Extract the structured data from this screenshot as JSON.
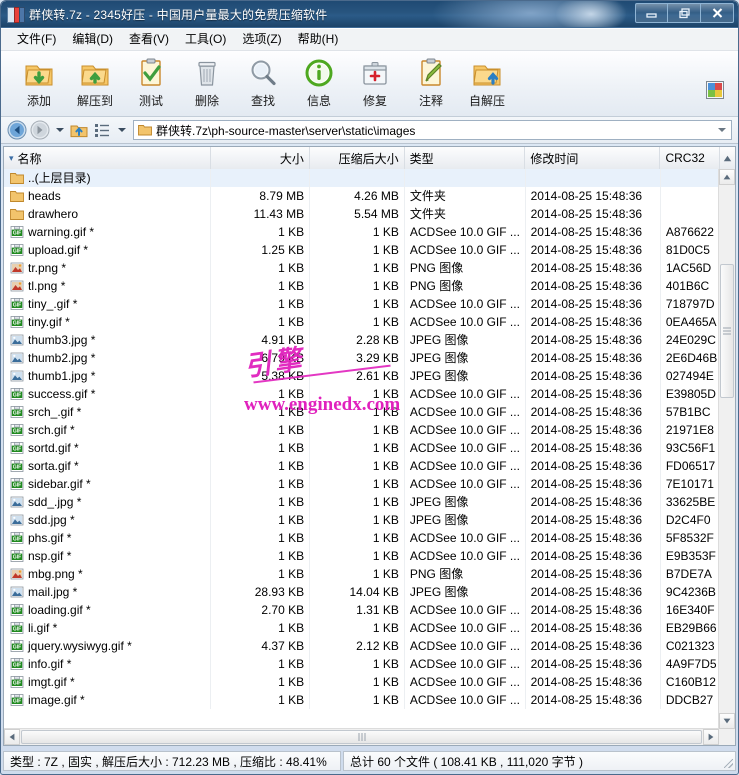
{
  "window": {
    "title": "群侠转.7z - 2345好压 - 中国用户量最大的免费压缩软件",
    "app_icon": "archive-icon",
    "minimize_label": "最小化",
    "restore_label": "还原",
    "close_label": "关闭"
  },
  "menu": [
    {
      "label": "文件(F)"
    },
    {
      "label": "编辑(D)"
    },
    {
      "label": "查看(V)"
    },
    {
      "label": "工具(O)"
    },
    {
      "label": "选项(Z)"
    },
    {
      "label": "帮助(H)"
    }
  ],
  "toolbar": {
    "buttons": [
      {
        "label": "添加",
        "icon": "folder-add-icon"
      },
      {
        "label": "解压到",
        "icon": "folder-extract-icon"
      },
      {
        "label": "测试",
        "icon": "clipboard-check-icon"
      },
      {
        "label": "删除",
        "icon": "trash-icon"
      },
      {
        "label": "查找",
        "icon": "magnifier-icon"
      },
      {
        "label": "信息",
        "icon": "info-icon"
      },
      {
        "label": "修复",
        "icon": "first-aid-icon"
      },
      {
        "label": "注释",
        "icon": "clipboard-pencil-icon"
      },
      {
        "label": "自解压",
        "icon": "folder-sfx-icon"
      }
    ],
    "right_icon": "palette-icon"
  },
  "address": {
    "back_icon": "back-arrow-icon",
    "forward_icon": "forward-arrow-icon",
    "dropdown_icon": "chevron-down-icon",
    "up_icon": "up-folder-icon",
    "view_icon": "list-view-icon",
    "view_dropdown_icon": "chevron-down-icon",
    "folder_icon": "folder-icon",
    "path": "群侠转.7z\\ph-source-master\\server\\static\\images"
  },
  "list": {
    "columns": [
      {
        "key": "name",
        "label": "名称",
        "align": "left",
        "sorted": true
      },
      {
        "key": "size",
        "label": "大小",
        "align": "right"
      },
      {
        "key": "psize",
        "label": "压缩后大小",
        "align": "right"
      },
      {
        "key": "type",
        "label": "类型",
        "align": "left"
      },
      {
        "key": "date",
        "label": "修改时间",
        "align": "left"
      },
      {
        "key": "crc",
        "label": "CRC32",
        "align": "left"
      }
    ],
    "rows": [
      {
        "icon": "folder-up-icon",
        "name": "..(上层目录)",
        "size": "",
        "psize": "",
        "type": "",
        "date": "",
        "crc": "",
        "selected": true
      },
      {
        "icon": "folder-icon",
        "name": "heads",
        "size": "8.79 MB",
        "psize": "4.26 MB",
        "type": "文件夹",
        "date": "2014-08-25 15:48:36",
        "crc": ""
      },
      {
        "icon": "folder-icon",
        "name": "drawhero",
        "size": "11.43 MB",
        "psize": "5.54 MB",
        "type": "文件夹",
        "date": "2014-08-25 15:48:36",
        "crc": ""
      },
      {
        "icon": "gif-icon",
        "name": "warning.gif *",
        "size": "1 KB",
        "psize": "1 KB",
        "type": "ACDSee 10.0 GIF ...",
        "date": "2014-08-25 15:48:36",
        "crc": "A876622"
      },
      {
        "icon": "gif-icon",
        "name": "upload.gif *",
        "size": "1.25 KB",
        "psize": "1 KB",
        "type": "ACDSee 10.0 GIF ...",
        "date": "2014-08-25 15:48:36",
        "crc": "81D0C5"
      },
      {
        "icon": "png-icon",
        "name": "tr.png *",
        "size": "1 KB",
        "psize": "1 KB",
        "type": "PNG 图像",
        "date": "2014-08-25 15:48:36",
        "crc": "1AC56D"
      },
      {
        "icon": "png-icon",
        "name": "tl.png *",
        "size": "1 KB",
        "psize": "1 KB",
        "type": "PNG 图像",
        "date": "2014-08-25 15:48:36",
        "crc": "401B6C"
      },
      {
        "icon": "gif-icon",
        "name": "tiny_.gif *",
        "size": "1 KB",
        "psize": "1 KB",
        "type": "ACDSee 10.0 GIF ...",
        "date": "2014-08-25 15:48:36",
        "crc": "718797D"
      },
      {
        "icon": "gif-icon",
        "name": "tiny.gif *",
        "size": "1 KB",
        "psize": "1 KB",
        "type": "ACDSee 10.0 GIF ...",
        "date": "2014-08-25 15:48:36",
        "crc": "0EA465A"
      },
      {
        "icon": "jpg-icon",
        "name": "thumb3.jpg *",
        "size": "4.91 KB",
        "psize": "2.28 KB",
        "type": "JPEG 图像",
        "date": "2014-08-25 15:48:36",
        "crc": "24E029C"
      },
      {
        "icon": "jpg-icon",
        "name": "thumb2.jpg *",
        "size": "6.79 KB",
        "psize": "3.29 KB",
        "type": "JPEG 图像",
        "date": "2014-08-25 15:48:36",
        "crc": "2E6D46B"
      },
      {
        "icon": "jpg-icon",
        "name": "thumb1.jpg *",
        "size": "5.38 KB",
        "psize": "2.61 KB",
        "type": "JPEG 图像",
        "date": "2014-08-25 15:48:36",
        "crc": "027494E"
      },
      {
        "icon": "gif-icon",
        "name": "success.gif *",
        "size": "1 KB",
        "psize": "1 KB",
        "type": "ACDSee 10.0 GIF ...",
        "date": "2014-08-25 15:48:36",
        "crc": "E39805D"
      },
      {
        "icon": "gif-icon",
        "name": "srch_.gif *",
        "size": "1 KB",
        "psize": "1 KB",
        "type": "ACDSee 10.0 GIF ...",
        "date": "2014-08-25 15:48:36",
        "crc": "57B1BC"
      },
      {
        "icon": "gif-icon",
        "name": "srch.gif *",
        "size": "1 KB",
        "psize": "1 KB",
        "type": "ACDSee 10.0 GIF ...",
        "date": "2014-08-25 15:48:36",
        "crc": "21971E8"
      },
      {
        "icon": "gif-icon",
        "name": "sortd.gif *",
        "size": "1 KB",
        "psize": "1 KB",
        "type": "ACDSee 10.0 GIF ...",
        "date": "2014-08-25 15:48:36",
        "crc": "93C56F1"
      },
      {
        "icon": "gif-icon",
        "name": "sorta.gif *",
        "size": "1 KB",
        "psize": "1 KB",
        "type": "ACDSee 10.0 GIF ...",
        "date": "2014-08-25 15:48:36",
        "crc": "FD06517"
      },
      {
        "icon": "gif-icon",
        "name": "sidebar.gif *",
        "size": "1 KB",
        "psize": "1 KB",
        "type": "ACDSee 10.0 GIF ...",
        "date": "2014-08-25 15:48:36",
        "crc": "7E10171"
      },
      {
        "icon": "jpg-icon",
        "name": "sdd_.jpg *",
        "size": "1 KB",
        "psize": "1 KB",
        "type": "JPEG 图像",
        "date": "2014-08-25 15:48:36",
        "crc": "33625BE"
      },
      {
        "icon": "jpg-icon",
        "name": "sdd.jpg *",
        "size": "1 KB",
        "psize": "1 KB",
        "type": "JPEG 图像",
        "date": "2014-08-25 15:48:36",
        "crc": "D2C4F0"
      },
      {
        "icon": "gif-icon",
        "name": "phs.gif *",
        "size": "1 KB",
        "psize": "1 KB",
        "type": "ACDSee 10.0 GIF ...",
        "date": "2014-08-25 15:48:36",
        "crc": "5F8532F"
      },
      {
        "icon": "gif-icon",
        "name": "nsp.gif *",
        "size": "1 KB",
        "psize": "1 KB",
        "type": "ACDSee 10.0 GIF ...",
        "date": "2014-08-25 15:48:36",
        "crc": "E9B353F"
      },
      {
        "icon": "png-icon",
        "name": "mbg.png *",
        "size": "1 KB",
        "psize": "1 KB",
        "type": "PNG 图像",
        "date": "2014-08-25 15:48:36",
        "crc": "B7DE7A"
      },
      {
        "icon": "jpg-icon",
        "name": "mail.jpg *",
        "size": "28.93 KB",
        "psize": "14.04 KB",
        "type": "JPEG 图像",
        "date": "2014-08-25 15:48:36",
        "crc": "9C4236B"
      },
      {
        "icon": "gif-icon",
        "name": "loading.gif *",
        "size": "2.70 KB",
        "psize": "1.31 KB",
        "type": "ACDSee 10.0 GIF ...",
        "date": "2014-08-25 15:48:36",
        "crc": "16E340F"
      },
      {
        "icon": "gif-icon",
        "name": "li.gif *",
        "size": "1 KB",
        "psize": "1 KB",
        "type": "ACDSee 10.0 GIF ...",
        "date": "2014-08-25 15:48:36",
        "crc": "EB29B66"
      },
      {
        "icon": "gif-icon",
        "name": "jquery.wysiwyg.gif *",
        "size": "4.37 KB",
        "psize": "2.12 KB",
        "type": "ACDSee 10.0 GIF ...",
        "date": "2014-08-25 15:48:36",
        "crc": "C021323"
      },
      {
        "icon": "gif-icon",
        "name": "info.gif *",
        "size": "1 KB",
        "psize": "1 KB",
        "type": "ACDSee 10.0 GIF ...",
        "date": "2014-08-25 15:48:36",
        "crc": "4A9F7D5"
      },
      {
        "icon": "gif-icon",
        "name": "imgt.gif *",
        "size": "1 KB",
        "psize": "1 KB",
        "type": "ACDSee 10.0 GIF ...",
        "date": "2014-08-25 15:48:36",
        "crc": "C160B12"
      },
      {
        "icon": "gif-icon",
        "name": "image.gif *",
        "size": "1 KB",
        "psize": "1 KB",
        "type": "ACDSee 10.0 GIF ...",
        "date": "2014-08-25 15:48:36",
        "crc": "DDCB27"
      }
    ]
  },
  "status": {
    "left": "类型 : 7Z , 固实 , 解压后大小 : 712.23 MB , 压缩比 : 48.41%",
    "right": "总计 60 个文件 ( 108.41 KB , 111,020 字节 )"
  },
  "watermark": {
    "script": "引擎",
    "url": "www.enginedx.com"
  },
  "colors": {
    "titlebar": "#28557f",
    "accent": "#3c6ea5",
    "selection": "#e8f1fb",
    "watermark": "#e021bd",
    "folder": "#f0b84d",
    "gif": "#2f8f2f"
  }
}
